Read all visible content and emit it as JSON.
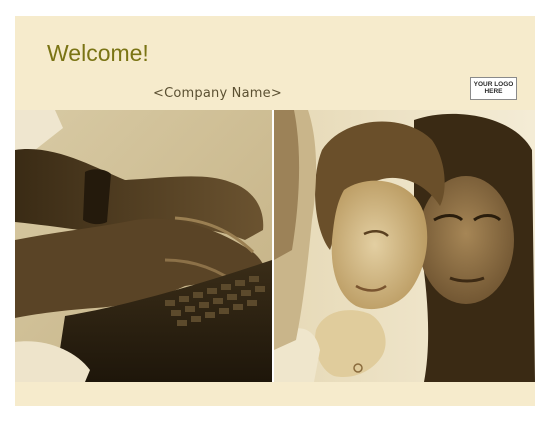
{
  "slide": {
    "welcome_text": "Welcome!",
    "company_placeholder": "<Company Name>",
    "logo_text": "YOUR LOGO\nHERE"
  },
  "images": {
    "left": "hands-typing-on-keyboard-photo",
    "right": "two-women-looking-at-screen-photo"
  },
  "colors": {
    "slide_background": "#f6ebcc",
    "title": "#7a7414",
    "sepia_dark": "#2a2010",
    "sepia_light": "#e8dcb8"
  }
}
